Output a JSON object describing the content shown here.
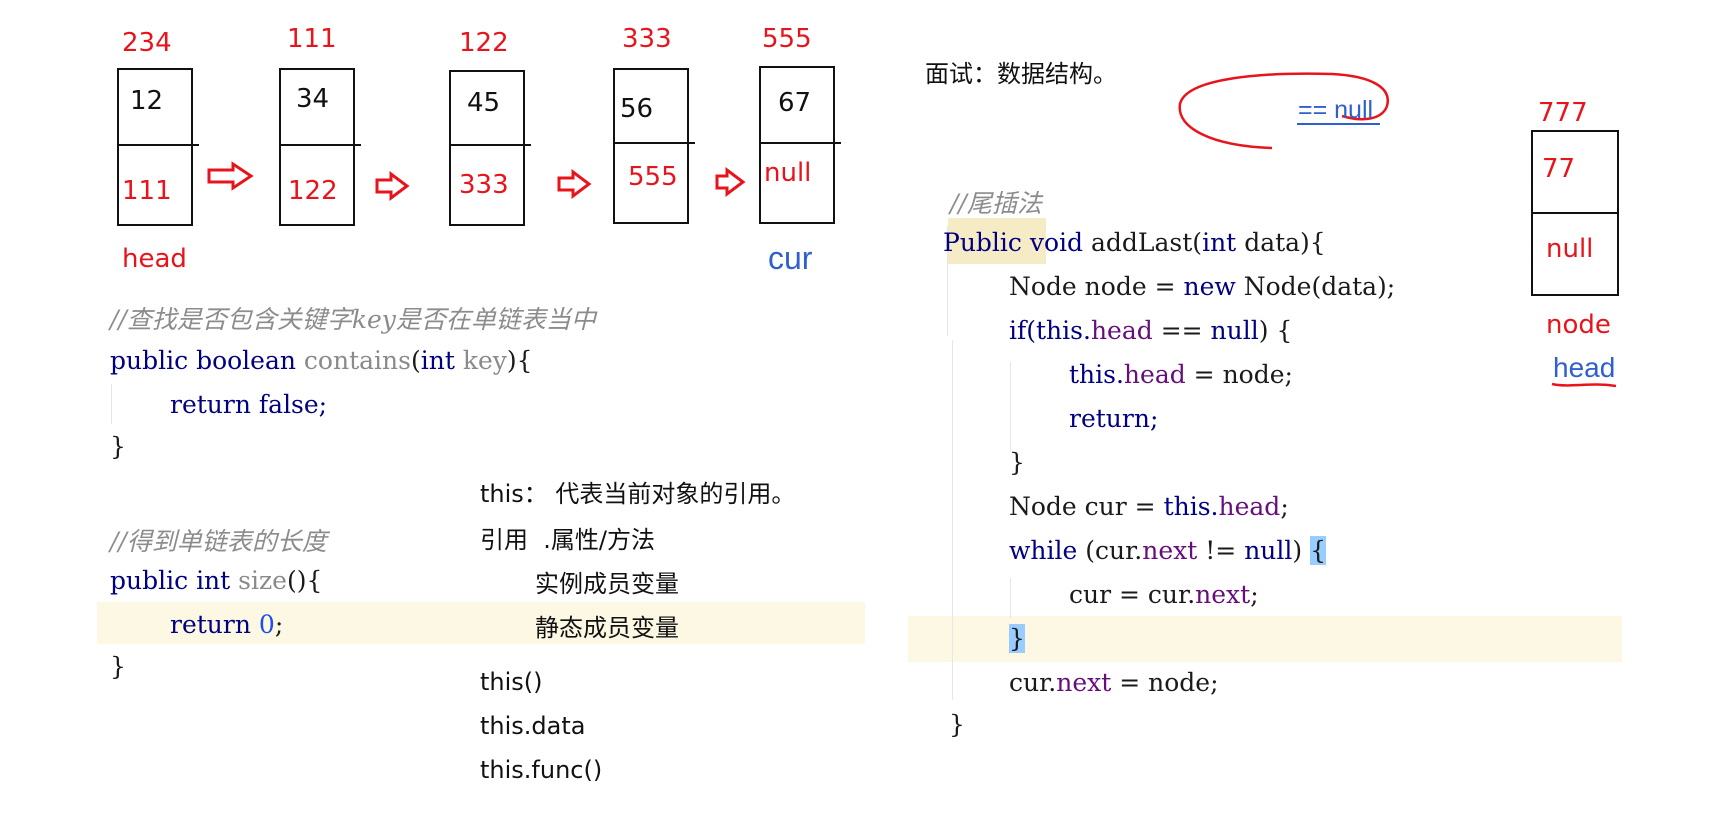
{
  "linked_list": {
    "nodes": [
      {
        "address": "234",
        "value": "12",
        "next": "111"
      },
      {
        "address": "111",
        "value": "34",
        "next": "122"
      },
      {
        "address": "122",
        "value": "45",
        "next": "333"
      },
      {
        "address": "333",
        "value": "56",
        "next": "555"
      },
      {
        "address": "555",
        "value": "67",
        "next": "null"
      }
    ],
    "head_label": "head",
    "cur_label": "cur"
  },
  "new_node": {
    "address": "777",
    "value": "77",
    "next": "null",
    "node_label": "node",
    "head_label": "head"
  },
  "annotation": {
    "equals_null": "== null"
  },
  "interview_note": "面试：数据结构。",
  "contains_block": {
    "comment": "//查找是否包含关键字key是否在单链表当中",
    "sig_public": "public",
    "sig_boolean": "boolean",
    "sig_name": "contains",
    "sig_int": "int",
    "sig_param": "key",
    "sig_brace": "{",
    "body_return": "return",
    "body_false": "false;",
    "close": "}"
  },
  "size_block": {
    "comment": "//得到单链表的长度",
    "sig_public": "public",
    "sig_int": "int",
    "sig_name": "size",
    "sig_parens": "()",
    "sig_brace": "{",
    "body_return": "return",
    "body_zero": "0",
    "close": "}"
  },
  "this_notes": {
    "line1": "this： 代表当前对象的引用。",
    "line2": "引用  .属性/方法",
    "line3": "实例成员变量",
    "line4": "静态成员变量",
    "line5": "this()",
    "line6": "this.data",
    "line7": "this.func()"
  },
  "addlast_block": {
    "comment": "//尾插法",
    "l1": {
      "a": "Public",
      "b": "void",
      "c": "addLast(",
      "d": "int",
      "e": "data){"
    },
    "l2": {
      "a": "Node node = ",
      "b": "new",
      "c": "Node(data);"
    },
    "l3": {
      "a": "if(",
      "b": "this.",
      "c": "head",
      "d": " == ",
      "e": "null",
      ")": ")",
      "f": " {"
    },
    "l4": {
      "a": "this.",
      "b": "head",
      "c": " = node;"
    },
    "l5": {
      "a": "return;"
    },
    "l6": {
      "a": "}"
    },
    "l7": {
      "a": "Node cur = ",
      "b": "this.",
      "c": "head",
      ";": ";"
    },
    "l8": {
      "a": "while",
      "b": " (cur.",
      "c": "next",
      "d": " != ",
      "e": "null",
      ")": ")",
      "f": "{"
    },
    "l9": {
      "a": "cur = cur.",
      "b": "next",
      ";": ";"
    },
    "l10": {
      "a": "}"
    },
    "l11": {
      "a": "cur.",
      "b": "next",
      "c": " = node;"
    },
    "l12": {
      "a": "}"
    }
  },
  "colors": {
    "red": "#e8141b",
    "keyword": "#000080",
    "field": "#660e7a",
    "comment": "#8c8c8c",
    "highlight": "#fdf8e4",
    "blue_pen": "#2f5fd0"
  }
}
